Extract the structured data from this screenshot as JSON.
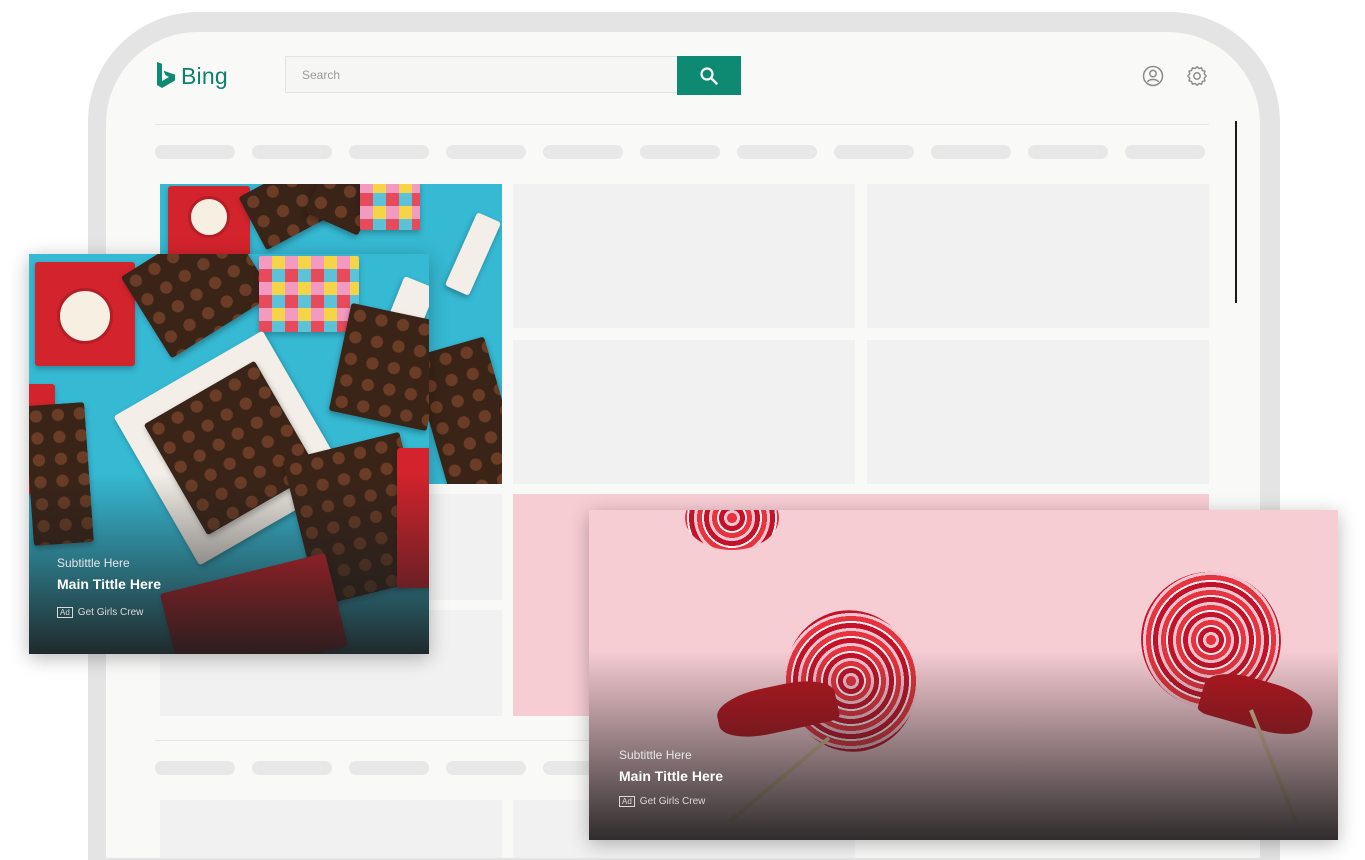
{
  "app": {
    "brand": "Bing"
  },
  "search": {
    "placeholder": "Search"
  },
  "icons": {
    "logo": "bing-b-icon",
    "search": "search-icon",
    "account": "account-icon",
    "settings": "gear-icon"
  },
  "colors": {
    "accent": "#0f8a72",
    "brand_text": "#0f7f6f"
  },
  "ad_card_1": {
    "subtitle": "Subtittle Here",
    "title": "Main Tittle Here",
    "badge": "Ad",
    "advertiser": "Get Girls Crew"
  },
  "ad_card_2": {
    "subtitle": "Subtittle Here",
    "title": "Main Tittle Here",
    "badge": "Ad",
    "advertiser": "Get Girls Crew"
  }
}
